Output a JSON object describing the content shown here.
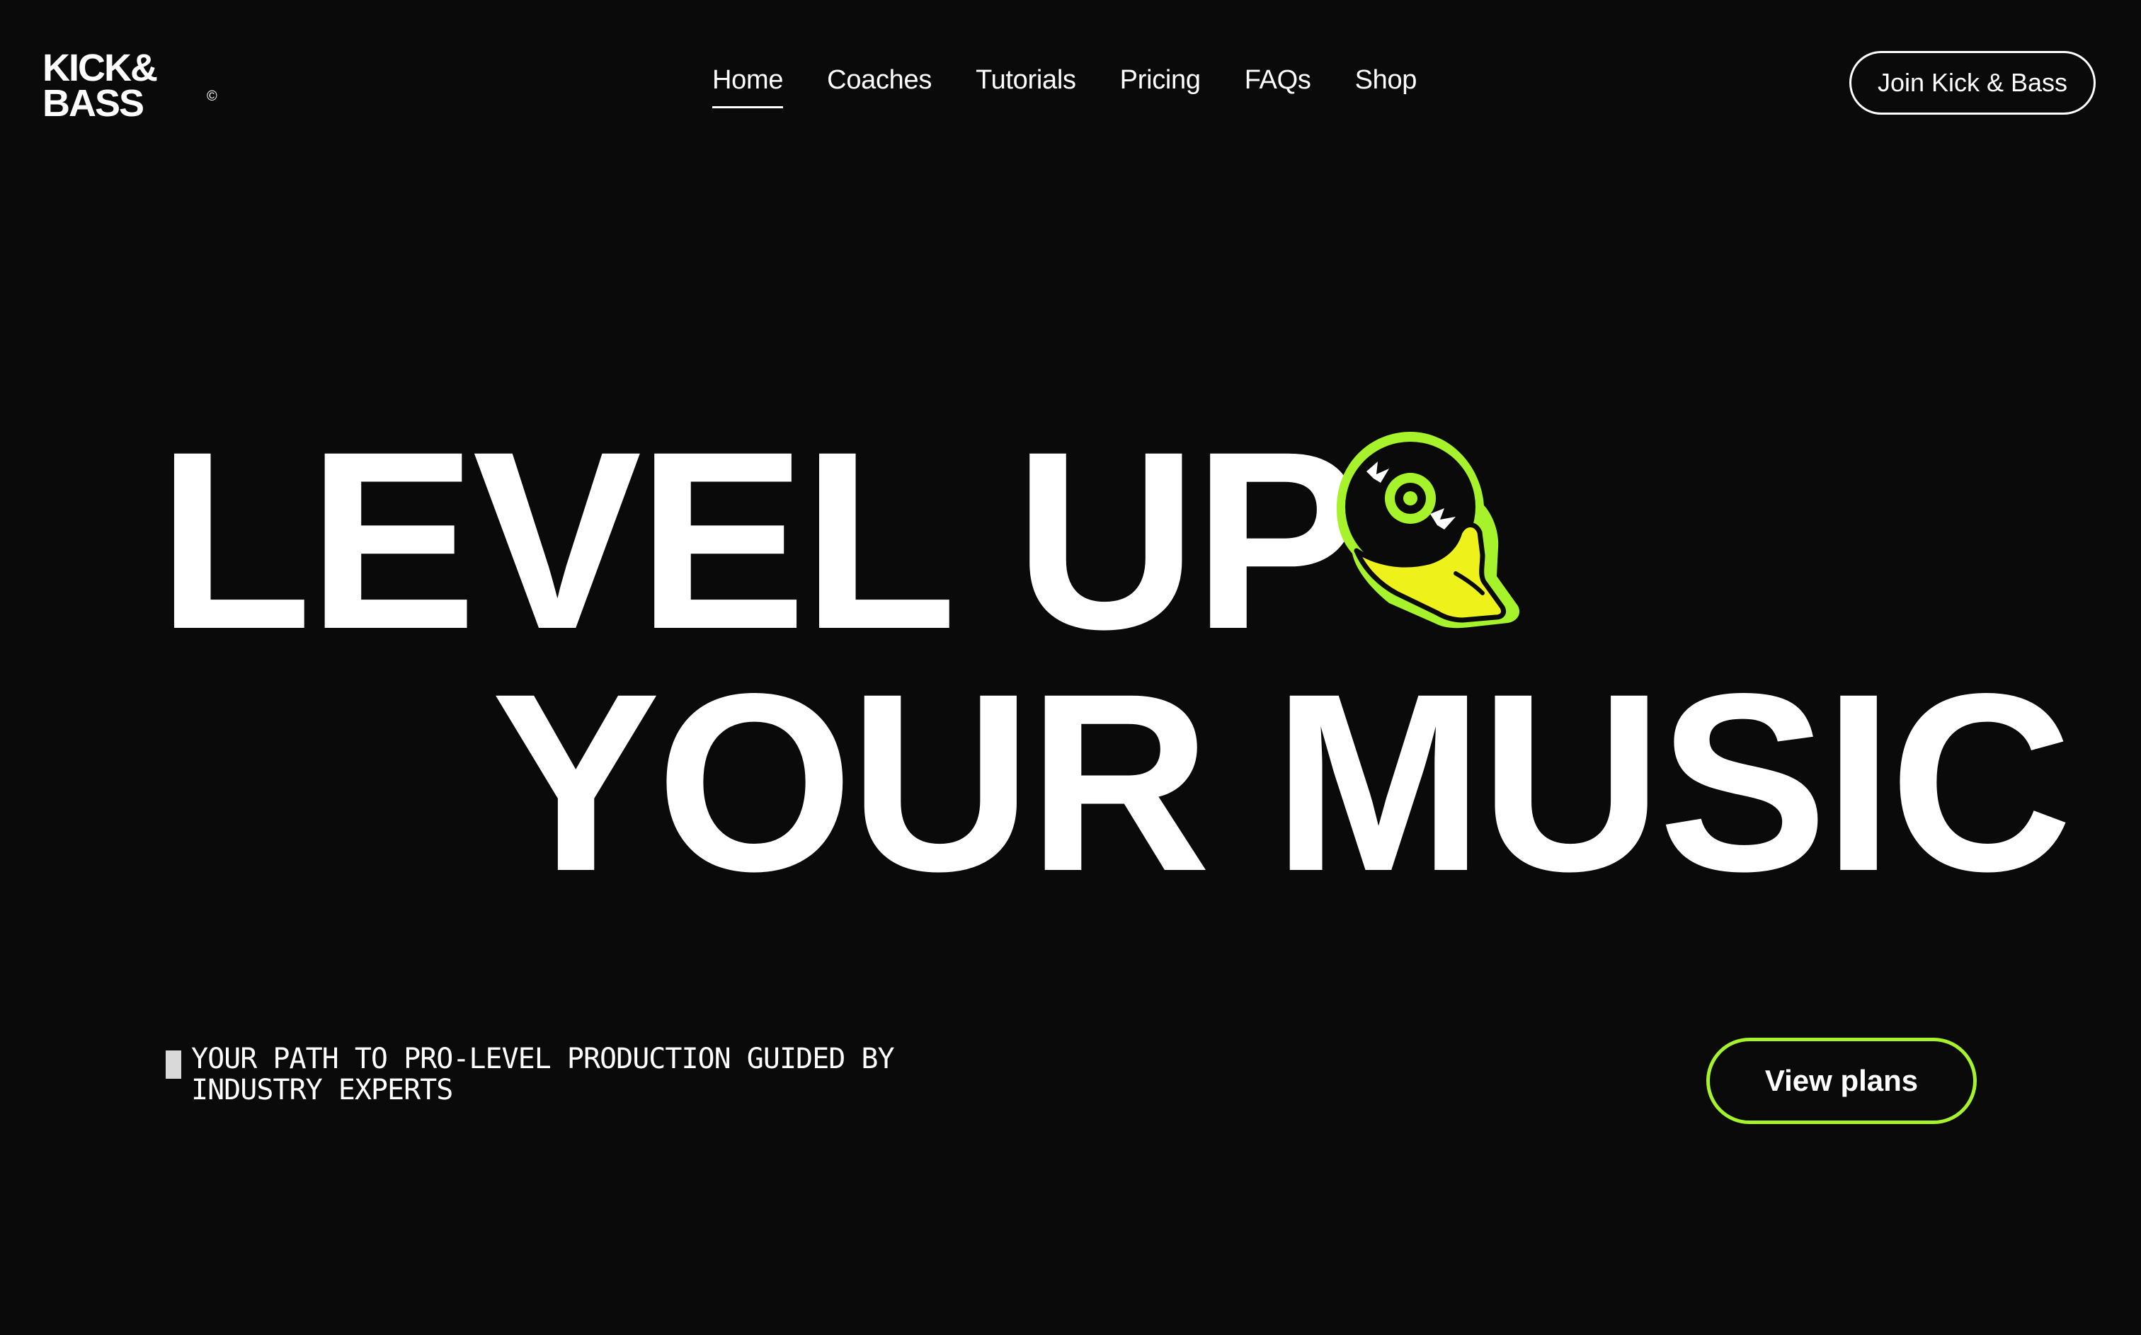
{
  "header": {
    "logo": {
      "line1": "KICK&",
      "line2": "BASS",
      "mark": "©"
    },
    "nav": [
      {
        "label": "Home",
        "active": true
      },
      {
        "label": "Coaches",
        "active": false
      },
      {
        "label": "Tutorials",
        "active": false
      },
      {
        "label": "Pricing",
        "active": false
      },
      {
        "label": "FAQs",
        "active": false
      },
      {
        "label": "Shop",
        "active": false
      }
    ],
    "cta_label": "Join Kick & Bass"
  },
  "hero": {
    "line1": "LEVEL UP",
    "line2": "YOUR MUSIC",
    "sticker_icon": "hand-holding-vinyl-record-icon"
  },
  "tagline": "YOUR PATH TO PRO-LEVEL PRODUCTION GUIDED BY INDUSTRY EXPERTS",
  "plans_button_label": "View plans",
  "colors": {
    "background": "#0a0a0a",
    "text": "#ffffff",
    "accent_green": "#a6f22b",
    "accent_yellow": "#eef21a"
  }
}
